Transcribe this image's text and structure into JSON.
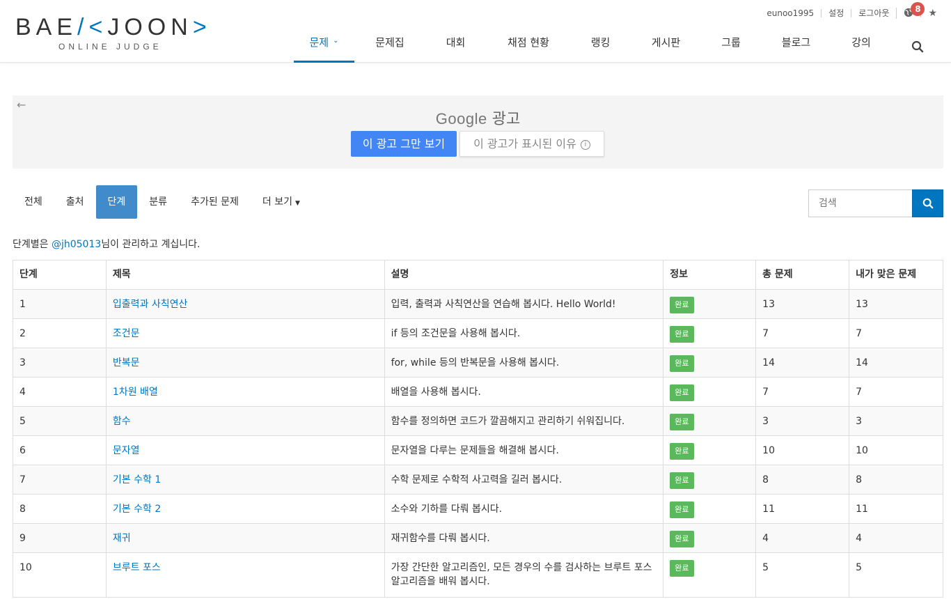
{
  "logo": {
    "left_bracket": "BAE",
    "mid": "K",
    "right": "JOON",
    "subtitle": "ONLINE JUDGE"
  },
  "top_links": {
    "user": "eunoo1995",
    "settings": "설정",
    "logout": "로그아웃",
    "notification_count": "8"
  },
  "nav": [
    {
      "label": "문제",
      "active": true,
      "has_caret": true
    },
    {
      "label": "문제집"
    },
    {
      "label": "대회"
    },
    {
      "label": "채점 현황"
    },
    {
      "label": "랭킹"
    },
    {
      "label": "게시판"
    },
    {
      "label": "그룹"
    },
    {
      "label": "블로그"
    },
    {
      "label": "강의"
    }
  ],
  "ad": {
    "brand": "Google",
    "label": "광고",
    "stop_button": "이 광고 그만 보기",
    "why_button": "이 광고가 표시된 이유"
  },
  "tabs": [
    "전체",
    "출처",
    "단계",
    "분류",
    "추가된 문제",
    "더 보기"
  ],
  "active_tab": "단계",
  "search": {
    "placeholder": "검색"
  },
  "manager": {
    "prefix": "단계별은 ",
    "handle": "@jh05013",
    "suffix": "님이 관리하고 계십니다."
  },
  "table": {
    "headers": [
      "단계",
      "제목",
      "설명",
      "정보",
      "총 문제",
      "내가 맞은 문제"
    ],
    "rows": [
      {
        "step": "1",
        "title": "입출력과 사칙연산",
        "desc": "입력, 출력과 사칙연산을 연습해 봅시다. Hello World!",
        "info": "완료",
        "total": "13",
        "solved": "13"
      },
      {
        "step": "2",
        "title": "조건문",
        "desc": "if 등의 조건문을 사용해 봅시다.",
        "info": "완료",
        "total": "7",
        "solved": "7"
      },
      {
        "step": "3",
        "title": "반복문",
        "desc": "for, while 등의 반복문을 사용해 봅시다.",
        "info": "완료",
        "total": "14",
        "solved": "14"
      },
      {
        "step": "4",
        "title": "1차원 배열",
        "desc": "배열을 사용해 봅시다.",
        "info": "완료",
        "total": "7",
        "solved": "7"
      },
      {
        "step": "5",
        "title": "함수",
        "desc": "함수를 정의하면 코드가 깔끔해지고 관리하기 쉬워집니다.",
        "info": "완료",
        "total": "3",
        "solved": "3"
      },
      {
        "step": "6",
        "title": "문자열",
        "desc": "문자열을 다루는 문제들을 해결해 봅시다.",
        "info": "완료",
        "total": "10",
        "solved": "10"
      },
      {
        "step": "7",
        "title": "기본 수학 1",
        "desc": "수학 문제로 수학적 사고력을 길러 봅시다.",
        "info": "완료",
        "total": "8",
        "solved": "8"
      },
      {
        "step": "8",
        "title": "기본 수학 2",
        "desc": "소수와 기하를 다뤄 봅시다.",
        "info": "완료",
        "total": "11",
        "solved": "11"
      },
      {
        "step": "9",
        "title": "재귀",
        "desc": "재귀함수를 다뤄 봅시다.",
        "info": "완료",
        "total": "4",
        "solved": "4"
      },
      {
        "step": "10",
        "title": "브루트 포스",
        "desc": "가장 간단한 알고리즘인, 모든 경우의 수를 검사하는 브루트 포스 알고리즘을 배워 봅시다.",
        "info": "완료",
        "total": "5",
        "solved": "5"
      }
    ]
  },
  "colors": {
    "brand": "#0076c0",
    "tab_active": "#428bca",
    "done": "#5cb85c",
    "badge": "#d9534f",
    "ad_button": "#4285f4"
  }
}
